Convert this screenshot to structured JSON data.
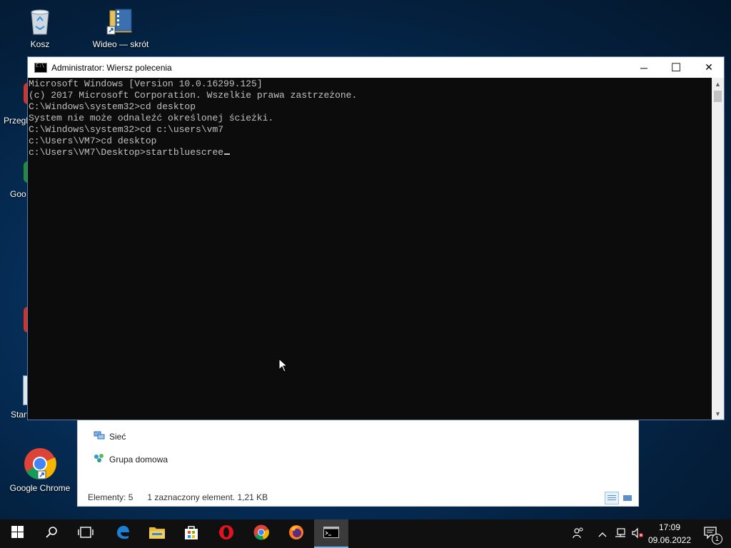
{
  "desktop": {
    "icons": [
      {
        "label": "Kosz",
        "icon": "recycle-bin-icon"
      },
      {
        "label": "Wideo — skrót",
        "icon": "video-shortcut-icon"
      },
      {
        "label": "Google Chrome",
        "icon": "chrome-icon"
      }
    ],
    "partial_labels": [
      "Przegl",
      "Goo",
      "Start"
    ]
  },
  "explorer": {
    "nav_items": [
      {
        "label": "Sieć",
        "icon": "network-icon"
      },
      {
        "label": "Grupa domowa",
        "icon": "homegroup-icon"
      }
    ],
    "status": {
      "items": "Elementy: 5",
      "selected": "1 zaznaczony element. 1,21 KB"
    }
  },
  "cmd_window": {
    "title": "Administrator: Wiersz polecenia",
    "lines": [
      "Microsoft Windows [Version 10.0.16299.125]",
      "(c) 2017 Microsoft Corporation. Wszelkie prawa zastrzeżone.",
      "",
      "C:\\Windows\\system32>cd desktop",
      "System nie może odnaleźć określonej ścieżki.",
      "",
      "C:\\Windows\\system32>cd c:\\users\\vm7",
      "",
      "c:\\Users\\VM7>cd desktop",
      "",
      "c:\\Users\\VM7\\Desktop>startbluescree"
    ],
    "buttons": {
      "minimize": "─",
      "maximize": "☐",
      "close": "✕"
    }
  },
  "taskbar": {
    "apps": [
      "start-icon",
      "search-icon",
      "task-view-icon",
      "edge-icon",
      "file-explorer-icon",
      "store-icon",
      "opera-icon",
      "chrome-icon",
      "firefox-icon",
      "cmd-icon"
    ],
    "clock": {
      "time": "17:09",
      "date": "09.06.2022"
    },
    "notifications": "1"
  },
  "colors": {
    "console_bg": "#0c0c0c",
    "console_text": "#c0c0c0",
    "taskbar": "#101010",
    "active_accent": "#76b9ed"
  }
}
